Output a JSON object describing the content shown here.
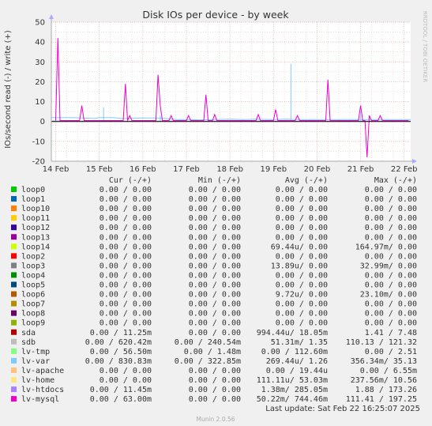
{
  "chart_data": {
    "type": "line",
    "title": "Disk IOs per device - by week",
    "ylabel": "IOs/second read (-) / write (+)",
    "side_label": "RRDTOOL / TOBI OETIKER",
    "ylim": [
      -20,
      50
    ],
    "yticks": [
      -20,
      -10,
      0,
      10,
      20,
      30,
      40,
      50
    ],
    "xlim": [
      -0.1,
      8.15
    ],
    "xticks": [
      {
        "x": 0,
        "label": "14 Feb"
      },
      {
        "x": 1,
        "label": "15 Feb"
      },
      {
        "x": 2,
        "label": "16 Feb"
      },
      {
        "x": 3,
        "label": "17 Feb"
      },
      {
        "x": 4,
        "label": "18 Feb"
      },
      {
        "x": 5,
        "label": "19 Feb"
      },
      {
        "x": 6,
        "label": "20 Feb"
      },
      {
        "x": 7,
        "label": "21 Feb"
      },
      {
        "x": 8,
        "label": "22 Feb"
      }
    ],
    "grid": true,
    "columns": [
      "Cur (-/+)",
      "Min (-/+)",
      "Avg (-/+)",
      "Max (-/+)"
    ],
    "series": [
      {
        "name": "loop0",
        "color": "#00cc00",
        "cur": "0.00 /   0.00",
        "min": "0.00 /   0.00",
        "avg": "0.00 /   0.00",
        "max": "0.00 /   0.00"
      },
      {
        "name": "loop1",
        "color": "#0066b3",
        "cur": "0.00 /   0.00",
        "min": "0.00 /   0.00",
        "avg": "0.00 /   0.00",
        "max": "0.00 /   0.00"
      },
      {
        "name": "loop10",
        "color": "#ff8000",
        "cur": "0.00 /   0.00",
        "min": "0.00 /   0.00",
        "avg": "0.00 /   0.00",
        "max": "0.00 /   0.00"
      },
      {
        "name": "loop11",
        "color": "#ffcc00",
        "cur": "0.00 /   0.00",
        "min": "0.00 /   0.00",
        "avg": "0.00 /   0.00",
        "max": "0.00 /   0.00"
      },
      {
        "name": "loop12",
        "color": "#330099",
        "cur": "0.00 /   0.00",
        "min": "0.00 /   0.00",
        "avg": "0.00 /   0.00",
        "max": "0.00 /   0.00"
      },
      {
        "name": "loop13",
        "color": "#990099",
        "cur": "0.00 /   0.00",
        "min": "0.00 /   0.00",
        "avg": "0.00 /   0.00",
        "max": "0.00 /   0.00"
      },
      {
        "name": "loop14",
        "color": "#ccff00",
        "cur": "0.00 /   0.00",
        "min": "0.00 /   0.00",
        "avg": "69.44u/   0.00",
        "max": "164.97m/   0.00"
      },
      {
        "name": "loop2",
        "color": "#ff0000",
        "cur": "0.00 /   0.00",
        "min": "0.00 /   0.00",
        "avg": "0.00 /   0.00",
        "max": "0.00 /   0.00"
      },
      {
        "name": "loop3",
        "color": "#808080",
        "cur": "0.00 /   0.00",
        "min": "0.00 /   0.00",
        "avg": "13.89u/   0.00",
        "max": "32.99m/   0.00"
      },
      {
        "name": "loop4",
        "color": "#008f00",
        "cur": "0.00 /   0.00",
        "min": "0.00 /   0.00",
        "avg": "0.00 /   0.00",
        "max": "0.00 /   0.00"
      },
      {
        "name": "loop5",
        "color": "#00487d",
        "cur": "0.00 /   0.00",
        "min": "0.00 /   0.00",
        "avg": "0.00 /   0.00",
        "max": "0.00 /   0.00"
      },
      {
        "name": "loop6",
        "color": "#b35a00",
        "cur": "0.00 /   0.00",
        "min": "0.00 /   0.00",
        "avg": "9.72u/   0.00",
        "max": "23.10m/   0.00"
      },
      {
        "name": "loop7",
        "color": "#b38f00",
        "cur": "0.00 /   0.00",
        "min": "0.00 /   0.00",
        "avg": "0.00 /   0.00",
        "max": "0.00 /   0.00"
      },
      {
        "name": "loop8",
        "color": "#6b006b",
        "cur": "0.00 /   0.00",
        "min": "0.00 /   0.00",
        "avg": "0.00 /   0.00",
        "max": "0.00 /   0.00"
      },
      {
        "name": "loop9",
        "color": "#8fb300",
        "cur": "0.00 /   0.00",
        "min": "0.00 /   0.00",
        "avg": "0.00 /   0.00",
        "max": "0.00 /   0.00"
      },
      {
        "name": "sda",
        "color": "#b30000",
        "cur": "0.00 /  11.25m",
        "min": "0.00 /   0.00",
        "avg": "994.44u/  18.05m",
        "max": "1.41 /   7.48"
      },
      {
        "name": "sdb",
        "color": "#bebebe",
        "cur": "0.00 / 620.42m",
        "min": "0.00 / 240.54m",
        "avg": "51.31m/   1.35",
        "max": "110.13 / 121.32"
      },
      {
        "name": "lv-tmp",
        "color": "#80ff80",
        "cur": "0.00 /  56.50m",
        "min": "0.00 /   1.48m",
        "avg": "0.00 / 112.60m",
        "max": "0.00 /   2.51"
      },
      {
        "name": "lv-var",
        "color": "#80c9ff",
        "cur": "0.00 / 830.83m",
        "min": "0.00 / 322.85m",
        "avg": "269.44u/   1.26",
        "max": "356.34m/  35.13"
      },
      {
        "name": "lv-apache",
        "color": "#ffc080",
        "cur": "0.00 /   0.00",
        "min": "0.00 /   0.00",
        "avg": "0.00 /  19.44u",
        "max": "0.00 /   6.55m"
      },
      {
        "name": "lv-home",
        "color": "#ffe680",
        "cur": "0.00 /   0.00",
        "min": "0.00 /   0.00",
        "avg": "111.11u/  53.03m",
        "max": "237.56m/  10.56"
      },
      {
        "name": "lv-htdocs",
        "color": "#aa80ff",
        "cur": "0.00 /  11.45m",
        "min": "0.00 /   0.00",
        "avg": "1.38m/ 285.05m",
        "max": "1.88 / 173.26"
      },
      {
        "name": "lv-mysql",
        "color": "#ee00cc",
        "cur": "0.00 /  63.00m",
        "min": "0.00 /   0.00",
        "avg": "50.22m/ 744.46m",
        "max": "111.41 / 197.25"
      }
    ],
    "plot_lines": {
      "lv_var": [
        [
          -0.2,
          2.0
        ],
        [
          0.0,
          2.0
        ],
        [
          0.3,
          2.0
        ],
        [
          0.6,
          1.8
        ],
        [
          0.9,
          1.5
        ],
        [
          1.0,
          2.0
        ],
        [
          1.3,
          2.0
        ],
        [
          1.5,
          1.5
        ],
        [
          1.7,
          1.5
        ],
        [
          2.0,
          1.8
        ],
        [
          2.3,
          1.8
        ],
        [
          2.5,
          1.5
        ],
        [
          2.8,
          1.0
        ],
        [
          3.0,
          1.0
        ],
        [
          3.3,
          0.8
        ],
        [
          3.6,
          1.0
        ],
        [
          4.0,
          1.2
        ],
        [
          4.3,
          1.0
        ],
        [
          4.6,
          1.2
        ],
        [
          5.0,
          1.0
        ],
        [
          5.3,
          1.2
        ],
        [
          5.6,
          1.0
        ],
        [
          6.0,
          1.0
        ],
        [
          6.3,
          1.0
        ],
        [
          6.6,
          1.0
        ],
        [
          7.0,
          1.0
        ],
        [
          7.3,
          1.0
        ],
        [
          7.6,
          1.0
        ],
        [
          8.0,
          1.0
        ],
        [
          8.15,
          1.0
        ]
      ],
      "lv_var_spikes": [
        [
          1.1,
          7.0
        ],
        [
          2.4,
          3.0
        ],
        [
          5.4,
          29.0
        ],
        [
          7.0,
          5.0
        ]
      ],
      "lv_mysql": [
        [
          0.0,
          0.5
        ],
        [
          0.05,
          42.0
        ],
        [
          0.1,
          0.5
        ],
        [
          0.55,
          0.5
        ],
        [
          0.6,
          8.0
        ],
        [
          0.65,
          0.5
        ],
        [
          1.55,
          0.5
        ],
        [
          1.6,
          19.0
        ],
        [
          1.65,
          0.5
        ],
        [
          1.7,
          3.0
        ],
        [
          1.75,
          0.5
        ],
        [
          2.3,
          0.5
        ],
        [
          2.35,
          23.5
        ],
        [
          2.4,
          8.0
        ],
        [
          2.45,
          0.5
        ],
        [
          2.6,
          0.5
        ],
        [
          2.65,
          3.0
        ],
        [
          2.7,
          0.5
        ],
        [
          3.0,
          0.5
        ],
        [
          3.05,
          3.0
        ],
        [
          3.1,
          0.5
        ],
        [
          3.4,
          0.5
        ],
        [
          3.45,
          13.5
        ],
        [
          3.5,
          0.5
        ],
        [
          3.6,
          0.5
        ],
        [
          3.65,
          3.5
        ],
        [
          3.7,
          0.5
        ],
        [
          4.6,
          0.5
        ],
        [
          4.65,
          3.5
        ],
        [
          4.7,
          0.5
        ],
        [
          5.0,
          0.5
        ],
        [
          5.05,
          6.0
        ],
        [
          5.1,
          0.5
        ],
        [
          5.5,
          0.5
        ],
        [
          5.55,
          3.0
        ],
        [
          5.6,
          0.5
        ],
        [
          6.2,
          0.5
        ],
        [
          6.25,
          21.0
        ],
        [
          6.3,
          0.5
        ],
        [
          6.95,
          0.5
        ],
        [
          7.0,
          8.0
        ],
        [
          7.05,
          0.5
        ],
        [
          7.1,
          0.5
        ],
        [
          7.15,
          -18.0
        ],
        [
          7.2,
          3.0
        ],
        [
          7.25,
          0.5
        ],
        [
          7.4,
          0.5
        ],
        [
          7.45,
          3.0
        ],
        [
          7.5,
          0.5
        ],
        [
          8.1,
          0.5
        ]
      ]
    }
  },
  "footer": {
    "last_update": "Last update: Sat Feb 22 16:25:07 2025",
    "version": "Munin 2.0.56"
  }
}
